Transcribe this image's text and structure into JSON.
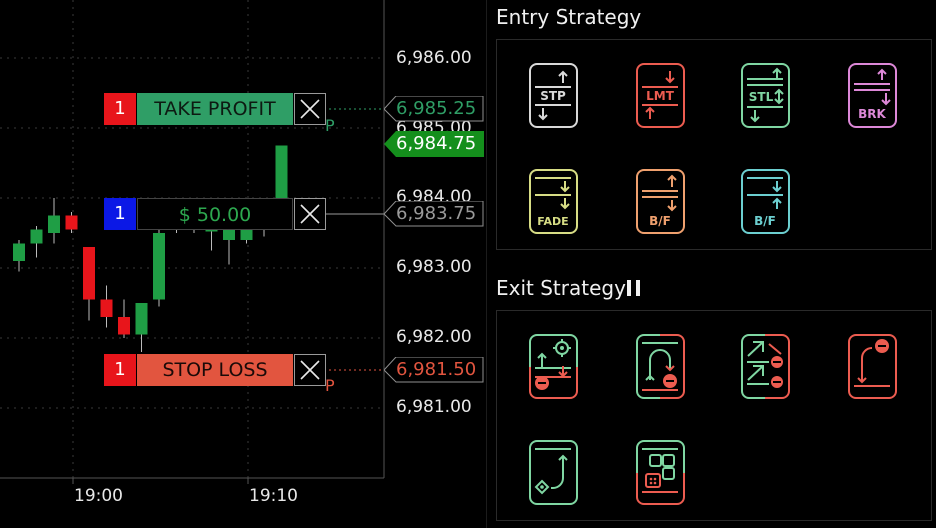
{
  "chart": {
    "price_labels": [
      {
        "text": "6,986.00",
        "price": 6986.0
      },
      {
        "text": "6,985.00",
        "price": 6985.0
      },
      {
        "text": "6,984.00",
        "price": 6984.0
      },
      {
        "text": "6,983.00",
        "price": 6983.0
      },
      {
        "text": "6,982.00",
        "price": 6982.0
      },
      {
        "text": "6,981.00",
        "price": 6981.0
      }
    ],
    "time_labels": [
      "19:00",
      "19:10"
    ],
    "current_price": "6,984.75",
    "take_profit": {
      "qty": "1",
      "label": "TAKE PROFIT",
      "price": "6,985.25",
      "marker": "P"
    },
    "position": {
      "qty": "1",
      "label": "$ 50.00",
      "price": "6,983.75"
    },
    "stop_loss": {
      "qty": "1",
      "label": "STOP LOSS",
      "price": "6,981.50",
      "marker": "P"
    },
    "colors": {
      "up": "#1f9e45",
      "down": "#e8151b",
      "take_profit": "#2f9e66",
      "stop_loss": "#e2553f",
      "position_qty": "#0b18e6",
      "current_price_bg": "#148f1c",
      "profit_text": "#2da84f"
    }
  },
  "chart_data": {
    "type": "candlestick",
    "candles": [
      {
        "open": 6983.1,
        "high": 6983.4,
        "low": 6982.95,
        "close": 6983.35
      },
      {
        "open": 6983.35,
        "high": 6983.6,
        "low": 6983.15,
        "close": 6983.55
      },
      {
        "open": 6983.5,
        "high": 6984.0,
        "low": 6983.35,
        "close": 6983.75
      },
      {
        "open": 6983.75,
        "high": 6983.8,
        "low": 6983.5,
        "close": 6983.55
      },
      {
        "open": 6983.3,
        "high": 6983.3,
        "low": 6982.25,
        "close": 6982.55
      },
      {
        "open": 6982.55,
        "high": 6982.75,
        "low": 6982.15,
        "close": 6982.3
      },
      {
        "open": 6982.3,
        "high": 6982.55,
        "low": 6982.0,
        "close": 6982.05
      },
      {
        "open": 6982.05,
        "high": 6982.5,
        "low": 6981.8,
        "close": 6982.5
      },
      {
        "open": 6982.55,
        "high": 6983.75,
        "low": 6982.45,
        "close": 6983.5
      },
      {
        "open": 6983.55,
        "high": 6983.75,
        "low": 6983.5,
        "close": 6983.6
      },
      {
        "open": 6983.7,
        "high": 6983.8,
        "low": 6983.5,
        "close": 6983.55
      },
      {
        "open": 6983.55,
        "high": 6983.65,
        "low": 6983.25,
        "close": 6983.55
      },
      {
        "open": 6983.4,
        "high": 6983.6,
        "low": 6983.05,
        "close": 6983.55
      },
      {
        "open": 6983.4,
        "high": 6983.75,
        "low": 6983.35,
        "close": 6983.65
      },
      {
        "open": 6983.6,
        "high": 6983.75,
        "low": 6983.45,
        "close": 6983.55
      },
      {
        "open": 6984.0,
        "high": 6984.75,
        "low": 6983.95,
        "close": 6984.75
      }
    ],
    "grid": true
  },
  "entry": {
    "title": "Entry Strategy",
    "buttons": [
      {
        "label": "STP",
        "color": "#d9d9d9"
      },
      {
        "label": "LMT",
        "color": "#ec5c50"
      },
      {
        "label": "STL",
        "color": "#7fd6a2"
      },
      {
        "label": "BRK",
        "color": "#dd88d8"
      },
      {
        "label": "FADE",
        "color": "#d7dd85"
      },
      {
        "label": "B/F",
        "color": "#efa06e"
      },
      {
        "label": "B/F",
        "color": "#6ccfd0"
      }
    ]
  },
  "exit": {
    "title": "Exit Strategy",
    "status_icon": "pause-icon",
    "buttons": [
      {
        "icon": "target-exit-icon"
      },
      {
        "icon": "reverse-exit-icon"
      },
      {
        "icon": "scale-out-exit-icon"
      },
      {
        "icon": "stop-exit-icon"
      },
      {
        "icon": "target-only-exit-icon"
      },
      {
        "icon": "grid-exit-icon"
      }
    ],
    "green": "#7fd6a2",
    "red": "#ec5c50"
  }
}
